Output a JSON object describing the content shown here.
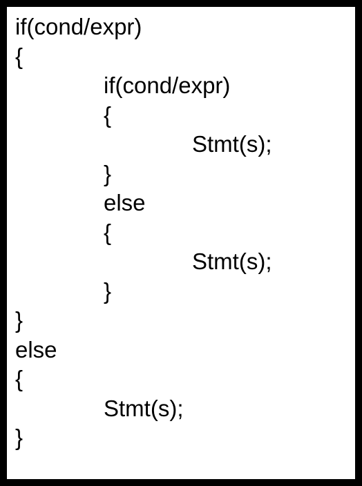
{
  "lines": [
    {
      "text": "if(cond/expr)",
      "indent": 0
    },
    {
      "text": "{",
      "indent": 0
    },
    {
      "text": "if(cond/expr)",
      "indent": 1
    },
    {
      "text": "{",
      "indent": 1
    },
    {
      "text": "Stmt(s);",
      "indent": 2
    },
    {
      "text": "}",
      "indent": 1
    },
    {
      "text": "else",
      "indent": 1
    },
    {
      "text": "{",
      "indent": 1
    },
    {
      "text": "Stmt(s);",
      "indent": 2
    },
    {
      "text": "}",
      "indent": 1
    },
    {
      "text": "}",
      "indent": 0
    },
    {
      "text": "else",
      "indent": 0
    },
    {
      "text": "{",
      "indent": 0
    },
    {
      "text": "Stmt(s);",
      "indent": 1
    },
    {
      "text": "}",
      "indent": 0
    }
  ]
}
